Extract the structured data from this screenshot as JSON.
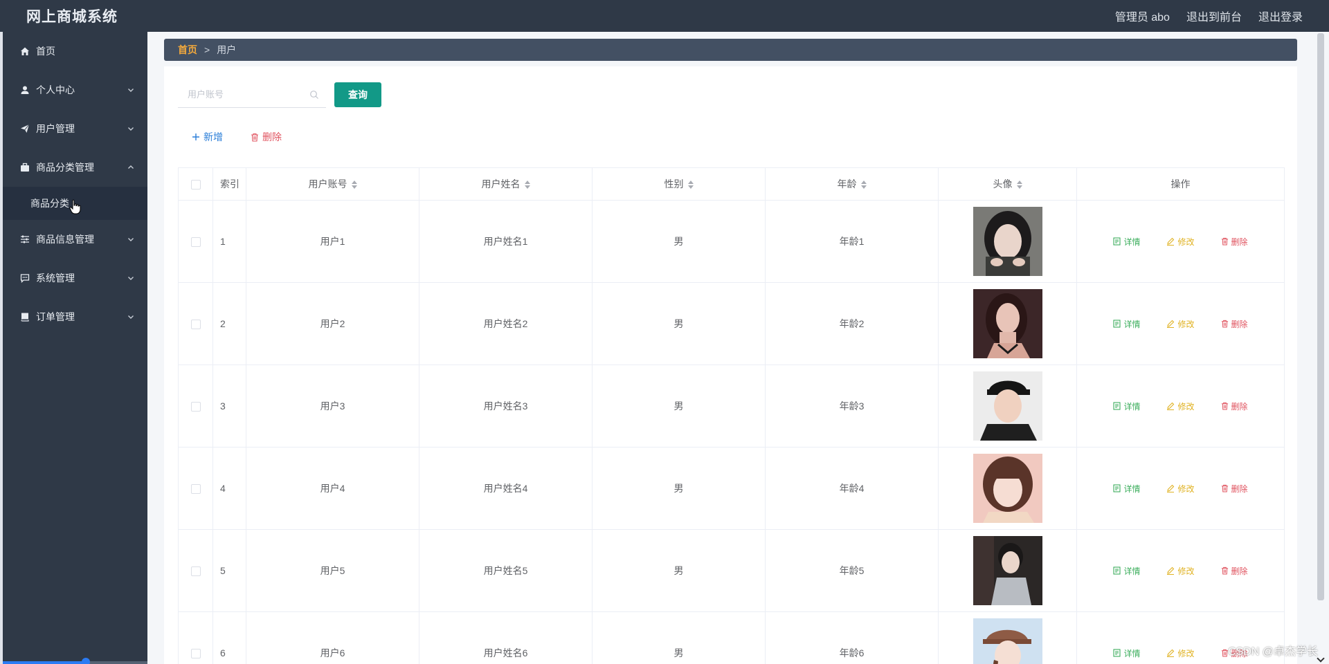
{
  "app": {
    "title": "网上商城系统"
  },
  "header": {
    "admin_label": "管理员 abo",
    "front_link": "退出到前台",
    "logout_link": "退出登录"
  },
  "sidebar": {
    "items": [
      {
        "label": "首页",
        "icon": "home-icon",
        "expanded": false,
        "has_children": false
      },
      {
        "label": "个人中心",
        "icon": "user-icon",
        "expanded": false,
        "has_children": true
      },
      {
        "label": "用户管理",
        "icon": "send-icon",
        "expanded": false,
        "has_children": true
      },
      {
        "label": "商品分类管理",
        "icon": "briefcase-icon",
        "expanded": true,
        "has_children": true
      },
      {
        "label": "商品信息管理",
        "icon": "sliders-icon",
        "expanded": false,
        "has_children": true
      },
      {
        "label": "系统管理",
        "icon": "chat-icon",
        "expanded": false,
        "has_children": true
      },
      {
        "label": "订单管理",
        "icon": "book-icon",
        "expanded": false,
        "has_children": true
      }
    ],
    "submenu": [
      {
        "label": "商品分类"
      }
    ]
  },
  "breadcrumb": {
    "home": "首页",
    "separator": ">",
    "current": "用户"
  },
  "search": {
    "placeholder": "用户账号",
    "value": "",
    "button_label": "查询"
  },
  "actions": {
    "add_label": "新增",
    "delete_label": "删除"
  },
  "table": {
    "columns": [
      "索引",
      "用户账号",
      "用户姓名",
      "性别",
      "年龄",
      "头像",
      "操作"
    ],
    "op_labels": {
      "detail": "详情",
      "edit": "修改",
      "delete": "删除"
    },
    "rows": [
      {
        "index": "1",
        "account": "用户1",
        "name": "用户姓名1",
        "gender": "男",
        "age": "年龄1"
      },
      {
        "index": "2",
        "account": "用户2",
        "name": "用户姓名2",
        "gender": "男",
        "age": "年龄2"
      },
      {
        "index": "3",
        "account": "用户3",
        "name": "用户姓名3",
        "gender": "男",
        "age": "年龄3"
      },
      {
        "index": "4",
        "account": "用户4",
        "name": "用户姓名4",
        "gender": "男",
        "age": "年龄4"
      },
      {
        "index": "5",
        "account": "用户5",
        "name": "用户姓名5",
        "gender": "男",
        "age": "年龄5"
      },
      {
        "index": "6",
        "account": "用户6",
        "name": "用户姓名6",
        "gender": "男",
        "age": "年龄6"
      }
    ]
  },
  "colors": {
    "sidebar_bg": "#2f3947",
    "breadcrumb_bg": "#435063",
    "query_button": "#129987",
    "detail": "#3cae5d",
    "edit": "#e0b222",
    "delete": "#e0535f",
    "add": "#2a7ed8"
  },
  "watermark": "CSDN @卓杰学长"
}
